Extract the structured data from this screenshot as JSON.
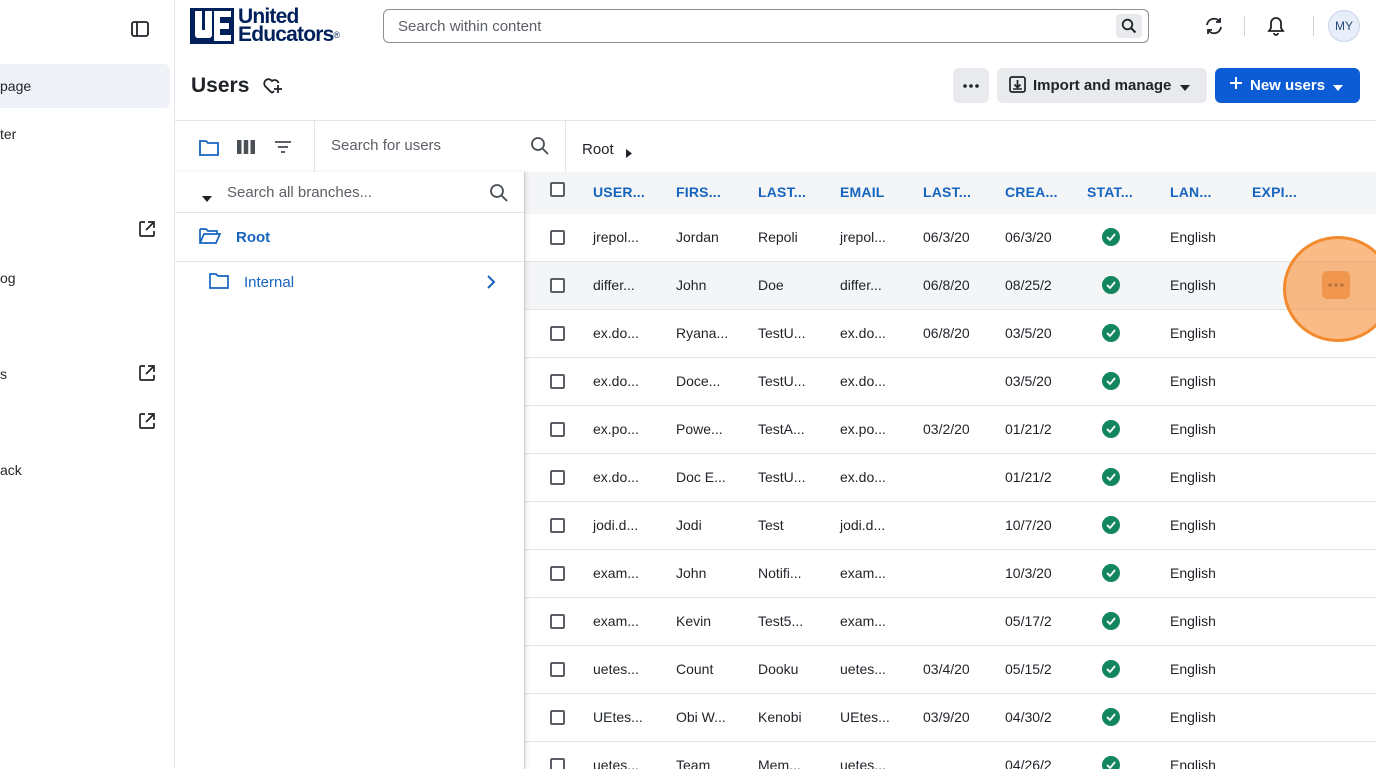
{
  "sidebar": {
    "items": [
      {
        "label": "page",
        "active": true,
        "external": false
      },
      {
        "label": "ter",
        "active": false,
        "external": false
      },
      {
        "label": "",
        "active": false,
        "external": true
      },
      {
        "label": "og",
        "active": false,
        "external": false
      },
      {
        "label": "s",
        "active": false,
        "external": true
      },
      {
        "label": "",
        "active": false,
        "external": true
      },
      {
        "label": "ack",
        "active": false,
        "external": false
      }
    ]
  },
  "header": {
    "logo_line1": "United",
    "logo_line2": "Educators",
    "logo_tm": "®",
    "search_placeholder": "Search within content",
    "avatar_initials": "MY"
  },
  "page": {
    "title": "Users",
    "import_label": "Import and manage",
    "new_users_label": "New users"
  },
  "toolbar": {
    "user_search_placeholder": "Search for users",
    "breadcrumb_root": "Root"
  },
  "branch_panel": {
    "search_placeholder": "Search all branches...",
    "root_label": "Root",
    "child_label": "Internal"
  },
  "table": {
    "columns": [
      "USER...",
      "FIRS...",
      "LAST...",
      "EMAIL",
      "LAST...",
      "CREA...",
      "STAT...",
      "LAN...",
      "EXPI..."
    ],
    "rows": [
      {
        "user": "jrepol...",
        "first": "Jordan",
        "last": "Repoli",
        "email": "jrepol...",
        "last_login": "06/3/20",
        "created": "06/3/20",
        "status": "active",
        "lang": "English"
      },
      {
        "user": "differ...",
        "first": "John",
        "last": "Doe",
        "email": "differ...",
        "last_login": "06/8/20",
        "created": "08/25/2",
        "status": "active",
        "lang": "English"
      },
      {
        "user": "ex.do...",
        "first": "Ryana...",
        "last": "TestU...",
        "email": "ex.do...",
        "last_login": "06/8/20",
        "created": "03/5/20",
        "status": "active",
        "lang": "English"
      },
      {
        "user": "ex.do...",
        "first": "Doce...",
        "last": "TestU...",
        "email": "ex.do...",
        "last_login": "",
        "created": "03/5/20",
        "status": "active",
        "lang": "English"
      },
      {
        "user": "ex.po...",
        "first": "Powe...",
        "last": "TestA...",
        "email": "ex.po...",
        "last_login": "03/2/20",
        "created": "01/21/2",
        "status": "active",
        "lang": "English"
      },
      {
        "user": "ex.do...",
        "first": "Doc E...",
        "last": "TestU...",
        "email": "ex.do...",
        "last_login": "",
        "created": "01/21/2",
        "status": "active",
        "lang": "English"
      },
      {
        "user": "jodi.d...",
        "first": "Jodi",
        "last": "Test",
        "email": "jodi.d...",
        "last_login": "",
        "created": "10/7/20",
        "status": "active",
        "lang": "English"
      },
      {
        "user": "exam...",
        "first": "John",
        "last": "Notifi...",
        "email": "exam...",
        "last_login": "",
        "created": "10/3/20",
        "status": "active",
        "lang": "English"
      },
      {
        "user": "exam...",
        "first": "Kevin",
        "last": "Test5...",
        "email": "exam...",
        "last_login": "",
        "created": "05/17/2",
        "status": "active",
        "lang": "English"
      },
      {
        "user": "uetes...",
        "first": "Count",
        "last": "Dooku",
        "email": "uetes...",
        "last_login": "03/4/20",
        "created": "05/15/2",
        "status": "active",
        "lang": "English"
      },
      {
        "user": "UEtes...",
        "first": "Obi W...",
        "last": "Kenobi",
        "email": "UEtes...",
        "last_login": "03/9/20",
        "created": "04/30/2",
        "status": "active",
        "lang": "English"
      },
      {
        "user": "uetes...",
        "first": "Team",
        "last": "Mem...",
        "email": "uetes...",
        "last_login": "",
        "created": "04/26/2",
        "status": "active",
        "lang": "English"
      }
    ]
  },
  "colors": {
    "brand_navy": "#00205b",
    "primary_blue": "#0b5cd5",
    "link_blue": "#1565c0",
    "status_green": "#13855f",
    "click_highlight": "#f28a2e"
  }
}
